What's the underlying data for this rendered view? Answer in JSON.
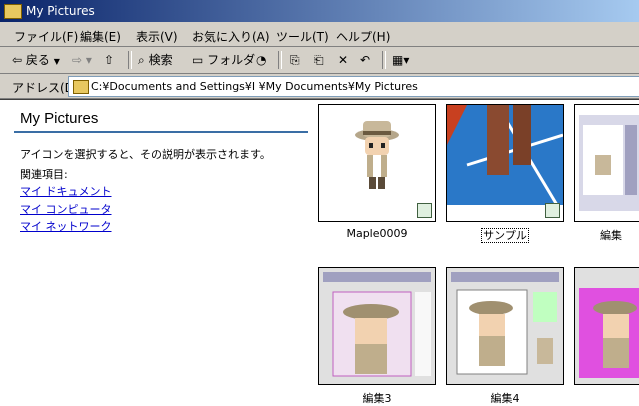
{
  "window": {
    "title": "My Pictures"
  },
  "menu": [
    "ファイル(F)",
    "編集(E)",
    "表示(V)",
    "お気に入り(A)",
    "ツール(T)",
    "ヘルプ(H)"
  ],
  "toolbar": {
    "back": "戻る",
    "search": "検索",
    "folders": "フォルダ"
  },
  "address": {
    "label": "アドレス(D)",
    "path": "C:¥Documents and Settings¥I       ¥My Documents¥My Pictures"
  },
  "panel": {
    "title": "My Pictures",
    "description": "アイコンを選択すると、その説明が表示されます。",
    "related_label": "関連項目:",
    "links": [
      "マイ ドキュメント",
      "マイ コンピュータ",
      "マイ ネットワーク"
    ]
  },
  "items": [
    {
      "name": "Maple0009"
    },
    {
      "name": "サンプル"
    },
    {
      "name": "編集"
    },
    {
      "name": "編集3"
    },
    {
      "name": "編集4"
    },
    {
      "name": ""
    }
  ]
}
